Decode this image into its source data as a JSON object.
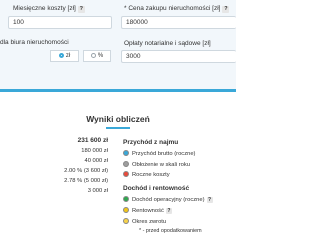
{
  "form": {
    "monthly_costs_label": "Miesięczne koszty [zł]",
    "monthly_costs_value": "100",
    "purchase_price_label": "* Cena zakupu nieruchomości [zł]",
    "purchase_price_value": "180000",
    "agency_label": "dla biura nieruchomości",
    "agency_options": [
      "zł",
      "%"
    ],
    "agency_selected": "zł",
    "notary_label": "Opłaty notarialne i sądowe [zł]",
    "notary_value": "3000",
    "help_glyph": "?"
  },
  "results": {
    "title": "Wyniki obliczeń",
    "values": [
      "231 600 zł",
      "180 000 zł",
      "40 000 zł",
      "2.00 % (3 600 zł)",
      "2.78 % (5 000 zł)",
      "3 000 zł"
    ],
    "income_section_title": "Przychód z najmu",
    "income_legend": [
      {
        "label": "Przychód brutto (roczne)",
        "color": "#3aa8d8",
        "icon": "blue-dot-icon"
      },
      {
        "label": "Obłożenie w skali roku",
        "color": "#9e9e9e",
        "icon": "gray-dot-icon"
      },
      {
        "label": "Roczne koszty",
        "color": "#e84a3b",
        "icon": "red-dot-icon"
      }
    ],
    "return_section_title": "Dochód i rentowność",
    "return_legend": [
      {
        "label": "Dochód operacyjny (roczne)",
        "color": "#2fa84f",
        "icon": "green-dot-icon",
        "help": true
      },
      {
        "label": "Rentowność",
        "color": "#f0c419",
        "icon": "yellow-dot-icon",
        "help": true
      },
      {
        "label": "Okres zwrotu",
        "color": "#f7d24a",
        "icon": "orange-dot-icon",
        "help": false
      }
    ],
    "note": "* - przed opodatkowaniem"
  }
}
